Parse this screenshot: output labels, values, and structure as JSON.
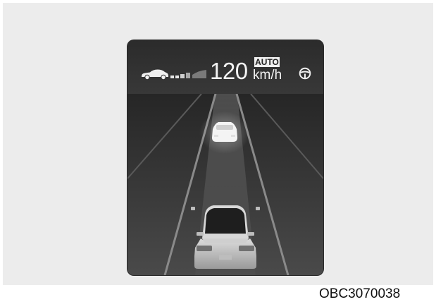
{
  "display": {
    "speed_value": "120",
    "auto_badge": "AUTO",
    "speed_unit": "km/h"
  },
  "icons": {
    "own_vehicle": "car-side-icon",
    "following_distance": "distance-bars-icon",
    "steering": "steering-wheel-icon"
  },
  "figure_code": "OBC3070038",
  "colors": {
    "background": "#ececec",
    "cluster_background": "#3a3a3a",
    "display_text": "#f2f2f2"
  }
}
